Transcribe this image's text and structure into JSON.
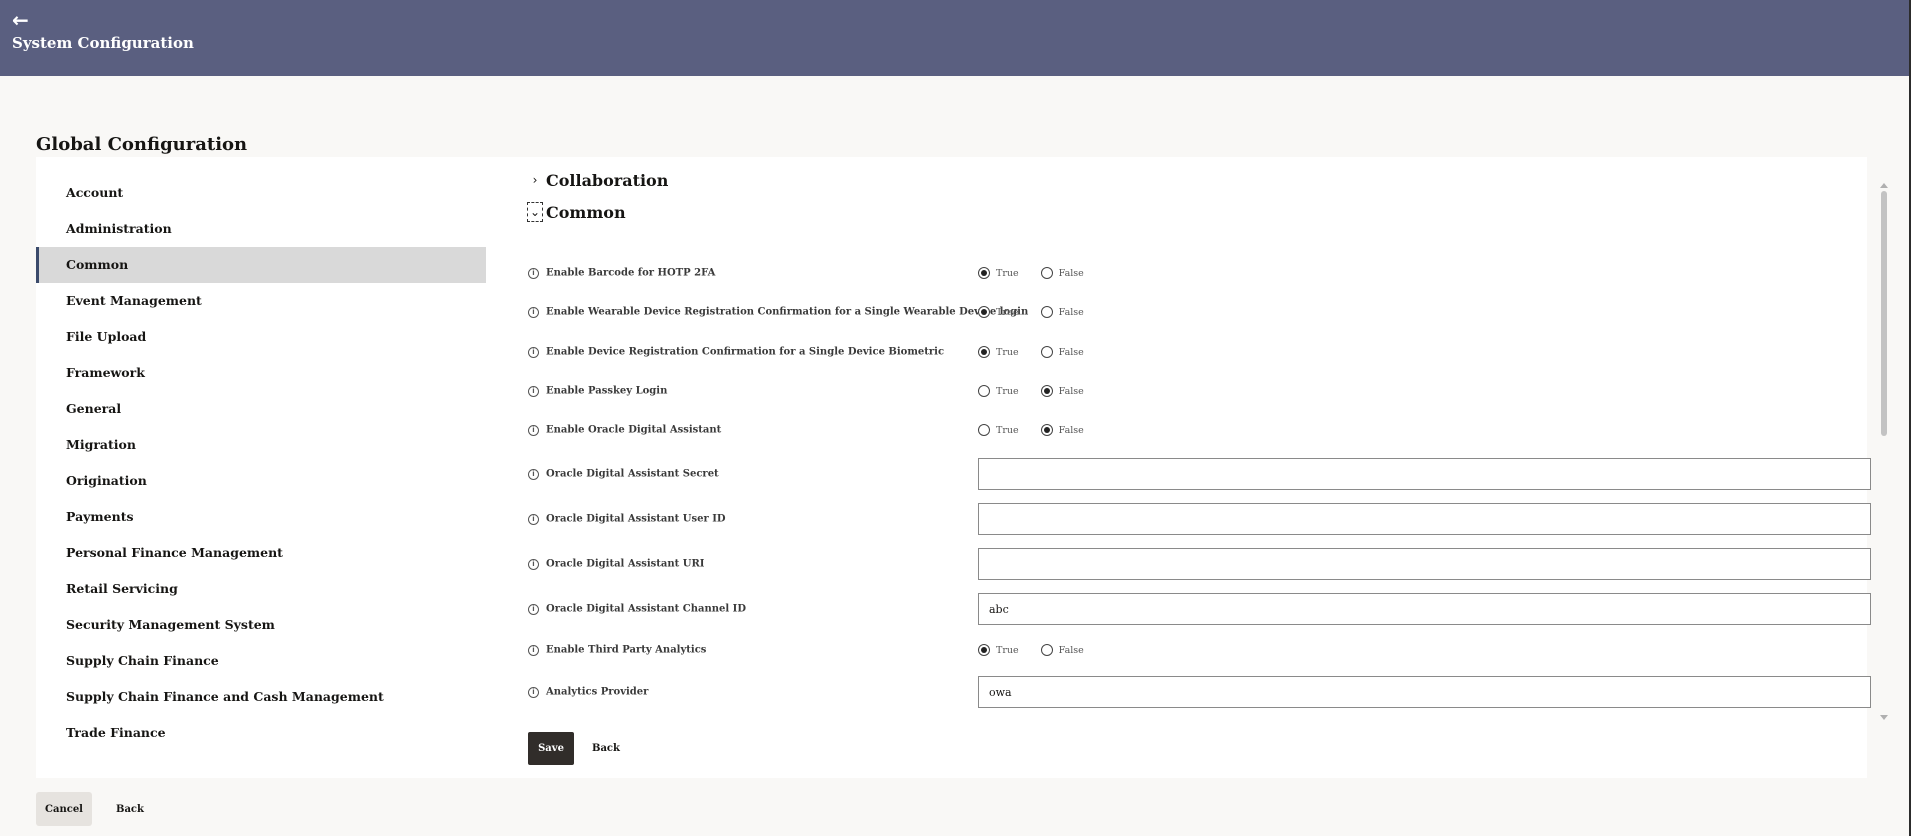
{
  "header": {
    "back_icon": "←",
    "title": "System Configuration"
  },
  "page": {
    "title": "Global Configuration"
  },
  "sidebar": {
    "active": "Common",
    "items": [
      {
        "label": "Account"
      },
      {
        "label": "Administration"
      },
      {
        "label": "Common"
      },
      {
        "label": "Event Management"
      },
      {
        "label": "File Upload"
      },
      {
        "label": "Framework"
      },
      {
        "label": "General"
      },
      {
        "label": "Migration"
      },
      {
        "label": "Origination"
      },
      {
        "label": "Payments"
      },
      {
        "label": "Personal Finance Management"
      },
      {
        "label": "Retail Servicing"
      },
      {
        "label": "Security Management System"
      },
      {
        "label": "Supply Chain Finance"
      },
      {
        "label": "Supply Chain Finance and Cash Management"
      },
      {
        "label": "Trade Finance"
      }
    ]
  },
  "sections": {
    "collaboration": {
      "title": "Collaboration",
      "chevron": "›",
      "expanded": false
    },
    "common": {
      "title": "Common",
      "chevron": "⌄",
      "expanded": true
    }
  },
  "info_icon": "i",
  "radio_labels": {
    "true": "True",
    "false": "False"
  },
  "settings": [
    {
      "label": "Enable Barcode for HOTP 2FA",
      "type": "radio",
      "value": "True"
    },
    {
      "label": "Enable Wearable Device Registration Confirmation for a Single Wearable Device login",
      "type": "radio",
      "value": "True"
    },
    {
      "label": "Enable Device Registration Confirmation for a Single Device Biometric",
      "type": "radio",
      "value": "True"
    },
    {
      "label": "Enable Passkey Login",
      "type": "radio",
      "value": "False"
    },
    {
      "label": "Enable Oracle Digital Assistant",
      "type": "radio",
      "value": "False"
    },
    {
      "label": "Oracle Digital Assistant Secret",
      "type": "text",
      "value": ""
    },
    {
      "label": "Oracle Digital Assistant User ID",
      "type": "text",
      "value": ""
    },
    {
      "label": "Oracle Digital Assistant URI",
      "type": "text",
      "value": ""
    },
    {
      "label": "Oracle Digital Assistant Channel ID",
      "type": "text",
      "value": "abc"
    },
    {
      "label": "Enable Third Party Analytics",
      "type": "radio",
      "value": "True"
    },
    {
      "label": "Analytics Provider",
      "type": "text",
      "value": "owa"
    }
  ],
  "buttons": {
    "save": "Save",
    "back_inner": "Back",
    "cancel": "Cancel",
    "back_outer": "Back"
  },
  "colors": {
    "header_bg": "#5a5f80",
    "primary_button": "#312d2a",
    "active_nav_bg": "#d9d9d9",
    "page_bg": "#f9f8f6"
  }
}
